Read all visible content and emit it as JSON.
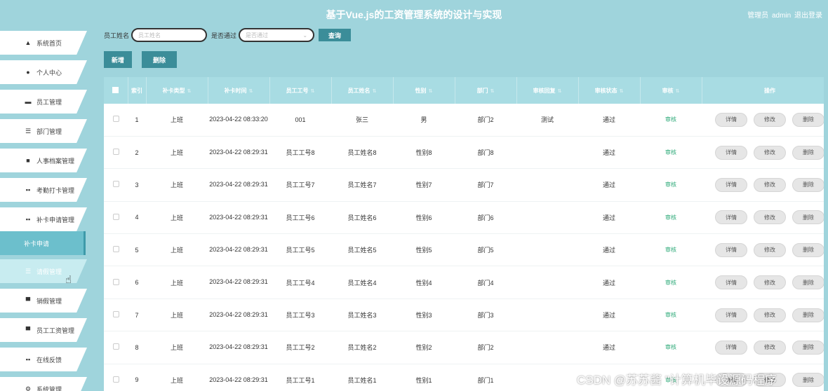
{
  "header": {
    "title": "基于Vue.js的工资管理系统的设计与实现",
    "role": "管理员",
    "username": "admin",
    "logout": "退出登录"
  },
  "sidebar": {
    "items": [
      {
        "label": "系统首页",
        "icon": "home-icon"
      },
      {
        "label": "个人中心",
        "icon": "user-icon"
      },
      {
        "label": "员工管理",
        "icon": "briefcase-icon"
      },
      {
        "label": "部门管理",
        "icon": "list-icon"
      },
      {
        "label": "人事档案管理",
        "icon": "archive-icon"
      },
      {
        "label": "考勤打卡管理",
        "icon": "grid-icon"
      },
      {
        "label": "补卡申请管理",
        "icon": "grid-icon"
      }
    ],
    "submenu_label": "补卡申请",
    "items_after": [
      {
        "label": "请假管理",
        "icon": "list-icon"
      },
      {
        "label": "销假管理",
        "icon": "monitor-icon"
      },
      {
        "label": "员工工资管理",
        "icon": "monitor-icon"
      },
      {
        "label": "在线反馈",
        "icon": "grid-icon"
      },
      {
        "label": "系统管理",
        "icon": "gear-icon"
      }
    ]
  },
  "filter": {
    "name_label": "员工姓名",
    "name_placeholder": "员工姓名",
    "pass_label": "是否通过",
    "pass_placeholder": "是否通过",
    "query_label": "查询"
  },
  "actions": {
    "add_label": "新增",
    "delete_label": "删除"
  },
  "table": {
    "headers": [
      "索引",
      "补卡类型",
      "补卡时间",
      "员工工号",
      "员工姓名",
      "性别",
      "部门",
      "审核回复",
      "审核状态",
      "审核",
      "操作"
    ],
    "rows": [
      {
        "index": "1",
        "type": "上班",
        "time": "2023-04-22 08:33:20",
        "id": "001",
        "name": "张三",
        "gender": "男",
        "dept": "部门2",
        "reply": "测试",
        "status": "通过"
      },
      {
        "index": "2",
        "type": "上班",
        "time": "2023-04-22 08:29:31",
        "id": "员工工号8",
        "name": "员工姓名8",
        "gender": "性别8",
        "dept": "部门8",
        "reply": "",
        "status": "通过"
      },
      {
        "index": "3",
        "type": "上班",
        "time": "2023-04-22 08:29:31",
        "id": "员工工号7",
        "name": "员工姓名7",
        "gender": "性别7",
        "dept": "部门7",
        "reply": "",
        "status": "通过"
      },
      {
        "index": "4",
        "type": "上班",
        "time": "2023-04-22 08:29:31",
        "id": "员工工号6",
        "name": "员工姓名6",
        "gender": "性别6",
        "dept": "部门6",
        "reply": "",
        "status": "通过"
      },
      {
        "index": "5",
        "type": "上班",
        "time": "2023-04-22 08:29:31",
        "id": "员工工号5",
        "name": "员工姓名5",
        "gender": "性别5",
        "dept": "部门5",
        "reply": "",
        "status": "通过"
      },
      {
        "index": "6",
        "type": "上班",
        "time": "2023-04-22 08:29:31",
        "id": "员工工号4",
        "name": "员工姓名4",
        "gender": "性别4",
        "dept": "部门4",
        "reply": "",
        "status": "通过"
      },
      {
        "index": "7",
        "type": "上班",
        "time": "2023-04-22 08:29:31",
        "id": "员工工号3",
        "name": "员工姓名3",
        "gender": "性别3",
        "dept": "部门3",
        "reply": "",
        "status": "通过"
      },
      {
        "index": "8",
        "type": "上班",
        "time": "2023-04-22 08:29:31",
        "id": "员工工号2",
        "name": "员工姓名2",
        "gender": "性别2",
        "dept": "部门2",
        "reply": "",
        "status": "通过"
      },
      {
        "index": "9",
        "type": "上班",
        "time": "2023-04-22 08:29:31",
        "id": "员工工号1",
        "name": "员工姓名1",
        "gender": "性别1",
        "dept": "部门1",
        "reply": "",
        "status": ""
      }
    ],
    "review_link": "审核",
    "op_detail": "详情",
    "op_edit": "修改",
    "op_delete": "删除"
  },
  "watermark": "CSDN @苏苏酱  \"计算机毕设源码程序"
}
